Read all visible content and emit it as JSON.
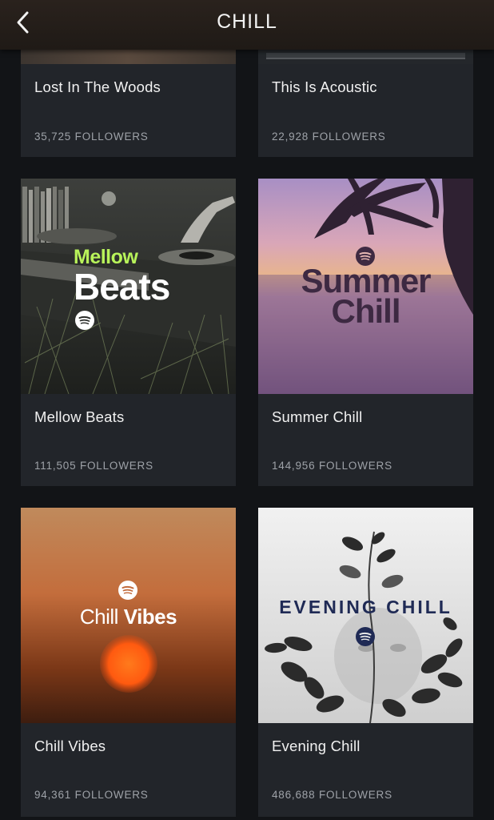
{
  "header": {
    "title": "CHILL",
    "back_icon": "chevron-left-icon"
  },
  "colors": {
    "background": "#121417",
    "card": "#22252a",
    "accent_green": "#b8f35a",
    "follower_text": "#9ea2a8"
  },
  "playlists": [
    {
      "name": "Lost In The Woods",
      "followers": "35,725 FOLLOWERS"
    },
    {
      "name": "This Is Acoustic",
      "followers": "22,928 FOLLOWERS"
    },
    {
      "name": "Mellow Beats",
      "followers": "111,505 FOLLOWERS",
      "art_line1": "Mellow",
      "art_line2": "Beats",
      "art_icon": "spotify-icon"
    },
    {
      "name": "Summer Chill",
      "followers": "144,956 FOLLOWERS",
      "art_line1": "Summer",
      "art_line2": "Chill",
      "art_icon": "spotify-icon"
    },
    {
      "name": "Chill Vibes",
      "followers": "94,361 FOLLOWERS",
      "art_line1": "Chill",
      "art_line2": "Vibes",
      "art_icon": "spotify-icon"
    },
    {
      "name": "Evening Chill",
      "followers": "486,688 FOLLOWERS",
      "art_line1": "EVENING CHILL",
      "art_icon": "spotify-icon"
    }
  ]
}
